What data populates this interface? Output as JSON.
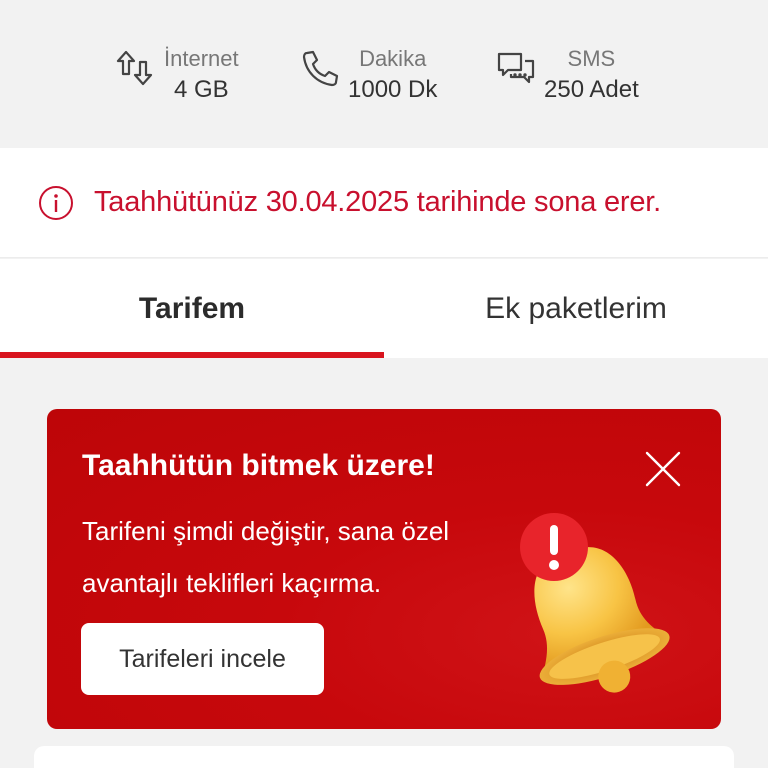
{
  "usage": {
    "internet": {
      "label": "İnternet",
      "value": "4 GB",
      "icon": "data-transfer-icon"
    },
    "minutes": {
      "label": "Dakika",
      "value": "1000 Dk",
      "icon": "phone-icon"
    },
    "sms": {
      "label": "SMS",
      "value": "250 Adet",
      "icon": "chat-icon"
    }
  },
  "notice": {
    "text": "Taahhütünüz 30.04.2025 tarihinde sona erer.",
    "icon": "info-icon"
  },
  "tabs": [
    {
      "label": "Tarifem",
      "active": true
    },
    {
      "label": "Ek paketlerim",
      "active": false
    }
  ],
  "promo": {
    "title": "Taahhütün bitmek üzere!",
    "body": "Tarifeni şimdi değiştir, sana özel avantajlı teklifleri kaçırma.",
    "button": "Tarifeleri incele",
    "close_icon": "close-icon",
    "illustration": "bell-alert-icon"
  },
  "colors": {
    "brand_red": "#d8141e",
    "notice_red": "#c8102e",
    "background": "#f2f2f2"
  }
}
